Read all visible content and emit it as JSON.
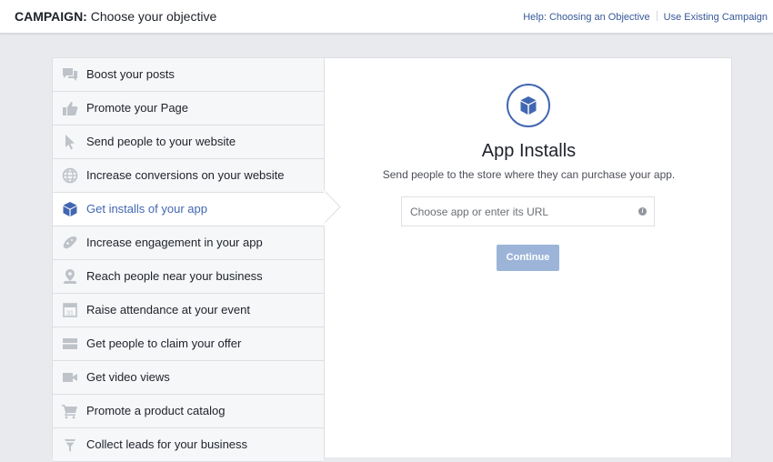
{
  "header": {
    "title_bold": "CAMPAIGN:",
    "title_rest": " Choose your objective",
    "help_link": "Help: Choosing an Objective",
    "existing_link": "Use Existing Campaign"
  },
  "sidebar": {
    "items": [
      {
        "label": "Boost your posts",
        "icon": "speech-bubbles-icon"
      },
      {
        "label": "Promote your Page",
        "icon": "thumbs-up-icon"
      },
      {
        "label": "Send people to your website",
        "icon": "cursor-icon"
      },
      {
        "label": "Increase conversions on your website",
        "icon": "globe-icon"
      },
      {
        "label": "Get installs of your app",
        "icon": "cube-icon",
        "selected": true
      },
      {
        "label": "Increase engagement in your app",
        "icon": "gamepad-icon"
      },
      {
        "label": "Reach people near your business",
        "icon": "map-pin-icon"
      },
      {
        "label": "Raise attendance at your event",
        "icon": "calendar-icon"
      },
      {
        "label": "Get people to claim your offer",
        "icon": "ticket-icon"
      },
      {
        "label": "Get video views",
        "icon": "video-camera-icon"
      },
      {
        "label": "Promote a product catalog",
        "icon": "shopping-cart-icon"
      },
      {
        "label": "Collect leads for your business",
        "icon": "funnel-icon"
      }
    ]
  },
  "main": {
    "heading": "App Installs",
    "description": "Send people to the store where they can purchase your app.",
    "app_input": {
      "placeholder": "Choose app or enter its URL",
      "value": ""
    },
    "info_glyph": "i",
    "continue_label": "Continue"
  },
  "colors": {
    "accent": "#4267b2",
    "icon_gray": "#bec3c9",
    "continue_disabled": "#9cb4d8",
    "background": "#e9eaed"
  }
}
